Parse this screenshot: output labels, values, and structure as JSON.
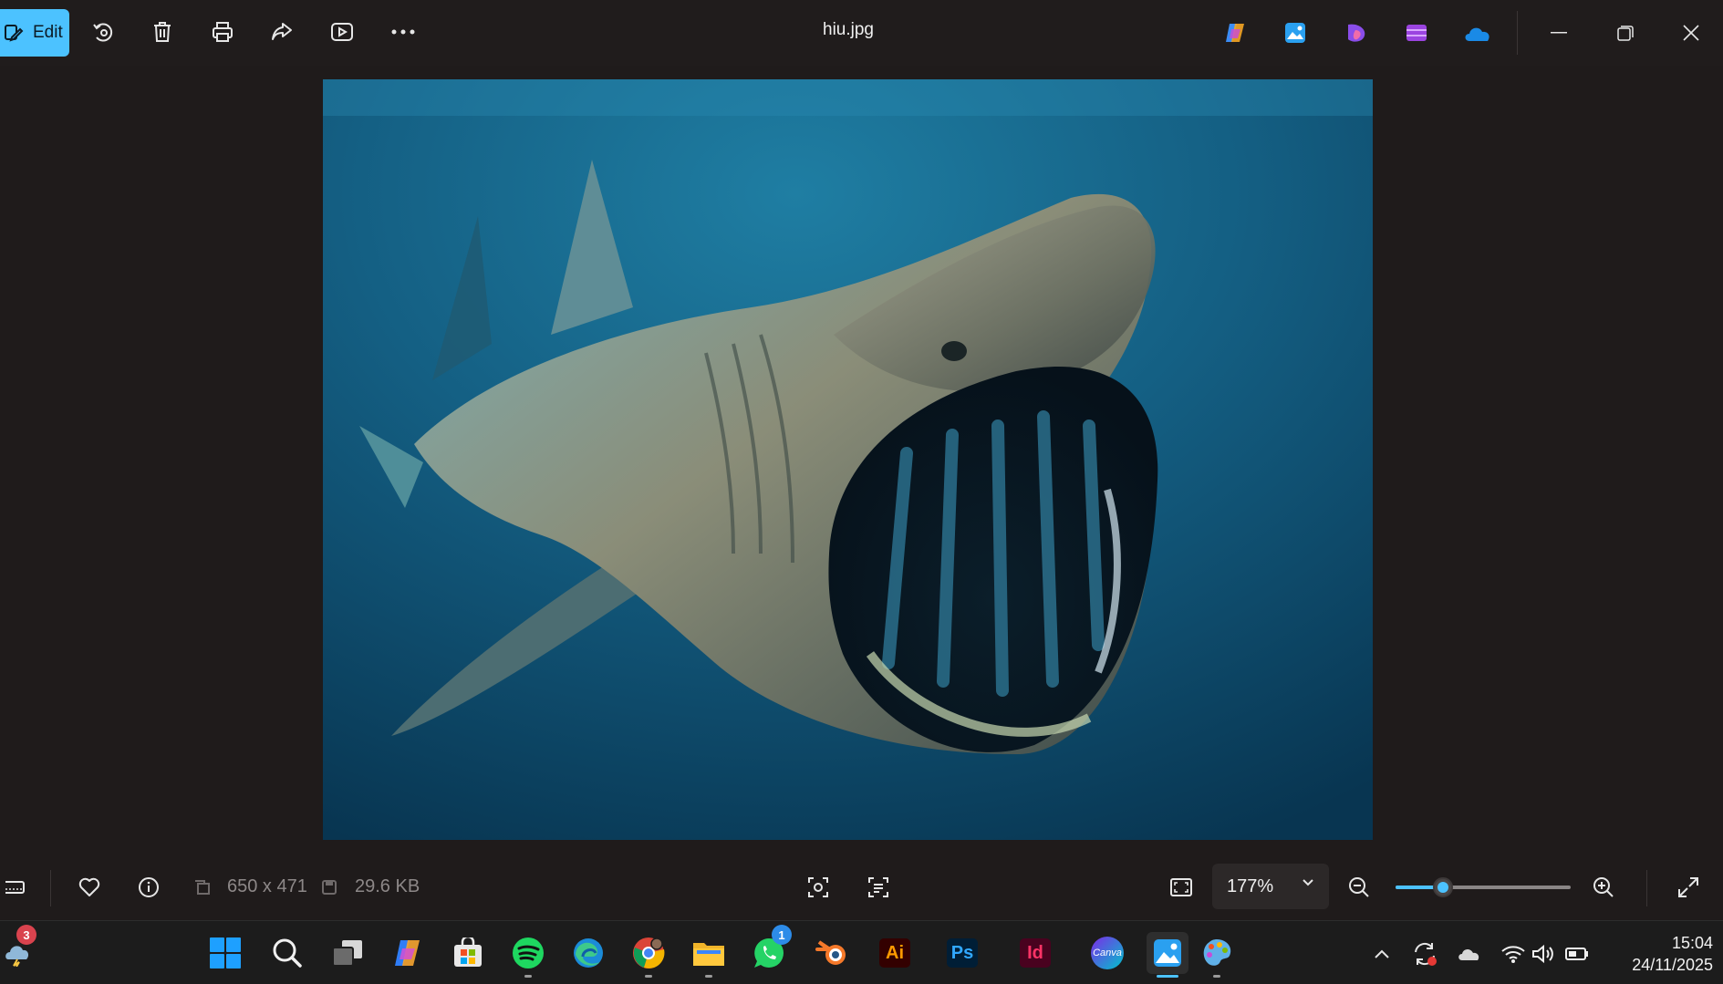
{
  "toolbar": {
    "edit_label": "Edit",
    "icons": [
      "rotate-icon",
      "delete-icon",
      "print-icon",
      "share-icon",
      "slideshow-icon",
      "more-icon"
    ]
  },
  "window": {
    "title": "hiu.jpg",
    "app_icons": [
      "copilot-icon",
      "photos-icon",
      "designer-icon",
      "clipchamp-icon",
      "onedrive-icon"
    ],
    "controls": [
      "minimize-icon",
      "restore-icon",
      "close-icon"
    ]
  },
  "image": {
    "subject": "basking-shark",
    "colors": {
      "water_light": "#1a6b8c",
      "water_dark": "#0b3a55",
      "shark": "#6f7a6c"
    }
  },
  "bottom_bar": {
    "dimensions": "650 x 471",
    "file_size": "29.6 KB",
    "zoom_label": "177%",
    "zoom_fraction": 0.27
  },
  "taskbar": {
    "weather_badge": "3",
    "whatsapp_badge": "1",
    "apps": [
      "start-icon",
      "search-icon",
      "task-view-icon",
      "copilot-icon",
      "store-icon",
      "spotify-icon",
      "edge-icon",
      "chrome-icon",
      "file-explorer-icon",
      "whatsapp-icon",
      "blender-icon",
      "illustrator-icon",
      "photoshop-icon",
      "indesign-icon",
      "canva-icon",
      "photos-icon",
      "paint-icon"
    ],
    "illustrator_label": "Ai",
    "photoshop_label": "Ps",
    "indesign_label": "Id",
    "canva_label": "Canva"
  },
  "clock": {
    "time": "15:04",
    "date": "24/11/2025"
  },
  "colors": {
    "accent": "#4cc2ff",
    "background": "#1f1b1b"
  }
}
